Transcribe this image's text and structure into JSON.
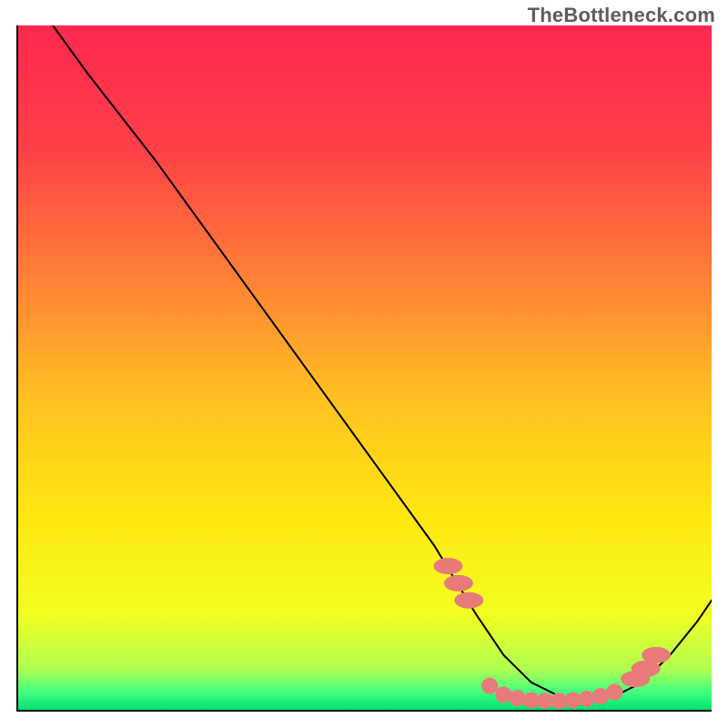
{
  "watermark": "TheBottleneck.com",
  "chart_data": {
    "type": "line",
    "title": "",
    "xlabel": "",
    "ylabel": "",
    "xlim": [
      0,
      100
    ],
    "ylim": [
      0,
      100
    ],
    "grid": false,
    "background_gradient": {
      "stops": [
        {
          "offset": 0.0,
          "color": "#ff2850"
        },
        {
          "offset": 0.18,
          "color": "#ff4048"
        },
        {
          "offset": 0.35,
          "color": "#ff7a38"
        },
        {
          "offset": 0.55,
          "color": "#ffc220"
        },
        {
          "offset": 0.72,
          "color": "#ffe810"
        },
        {
          "offset": 0.86,
          "color": "#f2ff20"
        },
        {
          "offset": 0.94,
          "color": "#b0ff50"
        },
        {
          "offset": 0.975,
          "color": "#40ff80"
        },
        {
          "offset": 1.0,
          "color": "#00e070"
        }
      ]
    },
    "series": [
      {
        "name": "bottleneck-curve",
        "color": "#000000",
        "width": 2,
        "x": [
          5,
          10,
          15,
          20,
          25,
          30,
          35,
          40,
          45,
          50,
          55,
          60,
          63,
          66,
          70,
          74,
          78,
          82,
          86,
          90,
          94,
          98,
          100
        ],
        "y": [
          100,
          93,
          86.5,
          80,
          73,
          66,
          59,
          52,
          45,
          38,
          31,
          24,
          19,
          14,
          8,
          4,
          2,
          1.5,
          2,
          4,
          8,
          13,
          16
        ]
      },
      {
        "name": "flat-marker-caps",
        "type": "scatter",
        "color": "#e97a7a",
        "x": [
          62,
          63.5,
          65,
          89,
          90.5,
          92
        ],
        "y": [
          21,
          18.5,
          16,
          4.5,
          6,
          8
        ],
        "rx": 2.1,
        "ry": 1.2
      },
      {
        "name": "flat-marker-valley",
        "type": "scatter",
        "color": "#e97a7a",
        "x": [
          68,
          70,
          72,
          74,
          76,
          78,
          80,
          82,
          84,
          86
        ],
        "y": [
          3.5,
          2.2,
          1.7,
          1.4,
          1.3,
          1.3,
          1.4,
          1.6,
          2.0,
          2.6
        ],
        "rx": 1.2,
        "ry": 1.2
      }
    ]
  }
}
